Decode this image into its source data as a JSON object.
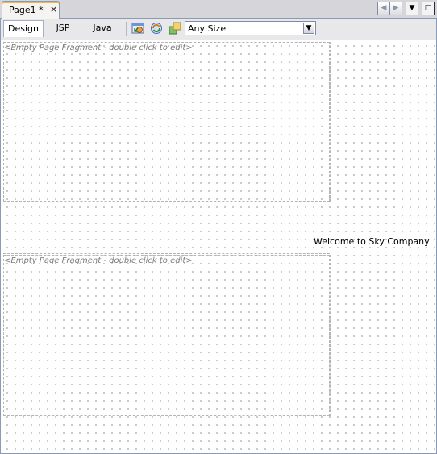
{
  "document_tab": {
    "title": "Page1 *",
    "close": "×"
  },
  "window_controls": {
    "prev": "◀",
    "next": "▶",
    "menu": "▼",
    "maximize": "□"
  },
  "view_tabs": [
    {
      "label": "Design",
      "active": true
    },
    {
      "label": "JSP",
      "active": false
    },
    {
      "label": "Java",
      "active": false
    }
  ],
  "toolbar": {
    "icons": [
      "preview-in-browser-icon",
      "refresh-icon",
      "toggle-virtual-forms-icon"
    ],
    "size_select": {
      "value": "Any Size",
      "arrow": "▼"
    }
  },
  "canvas": {
    "fragments": [
      {
        "label": "<Empty Page Fragment - double click to edit>"
      },
      {
        "label": "<Empty Page Fragment - double click to edit>"
      }
    ],
    "welcome_text": "Welcome to Sky Company"
  }
}
